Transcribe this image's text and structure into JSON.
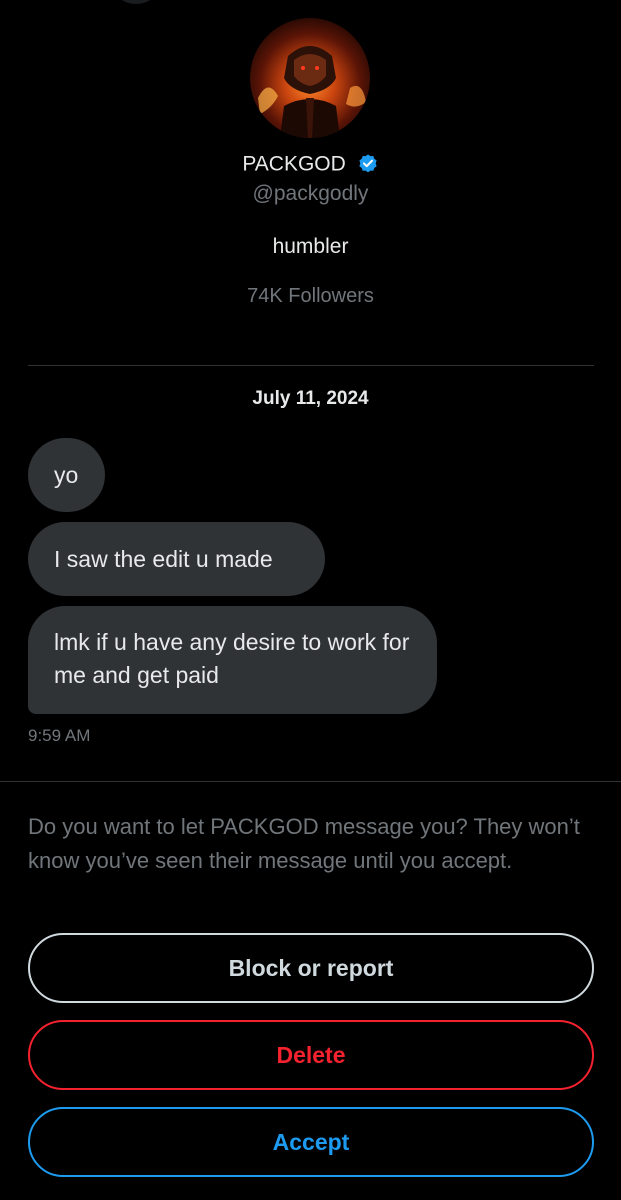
{
  "profile": {
    "display_name": "PACKGOD",
    "handle": "@packgodly",
    "bio": "humbler",
    "followers": "74K Followers",
    "verified_icon": "verified-badge-icon"
  },
  "conversation": {
    "date": "July 11, 2024",
    "messages": [
      {
        "text": "yo"
      },
      {
        "text": "I saw the edit u made"
      },
      {
        "text": "lmk if u have any desire to work for me and get paid"
      }
    ],
    "timestamp": "9:59 AM"
  },
  "request": {
    "prompt": "Do you want to let PACKGOD message you? They won’t know you’ve seen their message until you accept.",
    "block_label": "Block or report",
    "delete_label": "Delete",
    "accept_label": "Accept"
  },
  "colors": {
    "background": "#000000",
    "bubble": "#2f3336",
    "primary_text": "#e7e9ea",
    "secondary_text": "#71767b",
    "verified": "#1d9bf0",
    "danger": "#f4212e",
    "accept": "#1d9bf0"
  }
}
